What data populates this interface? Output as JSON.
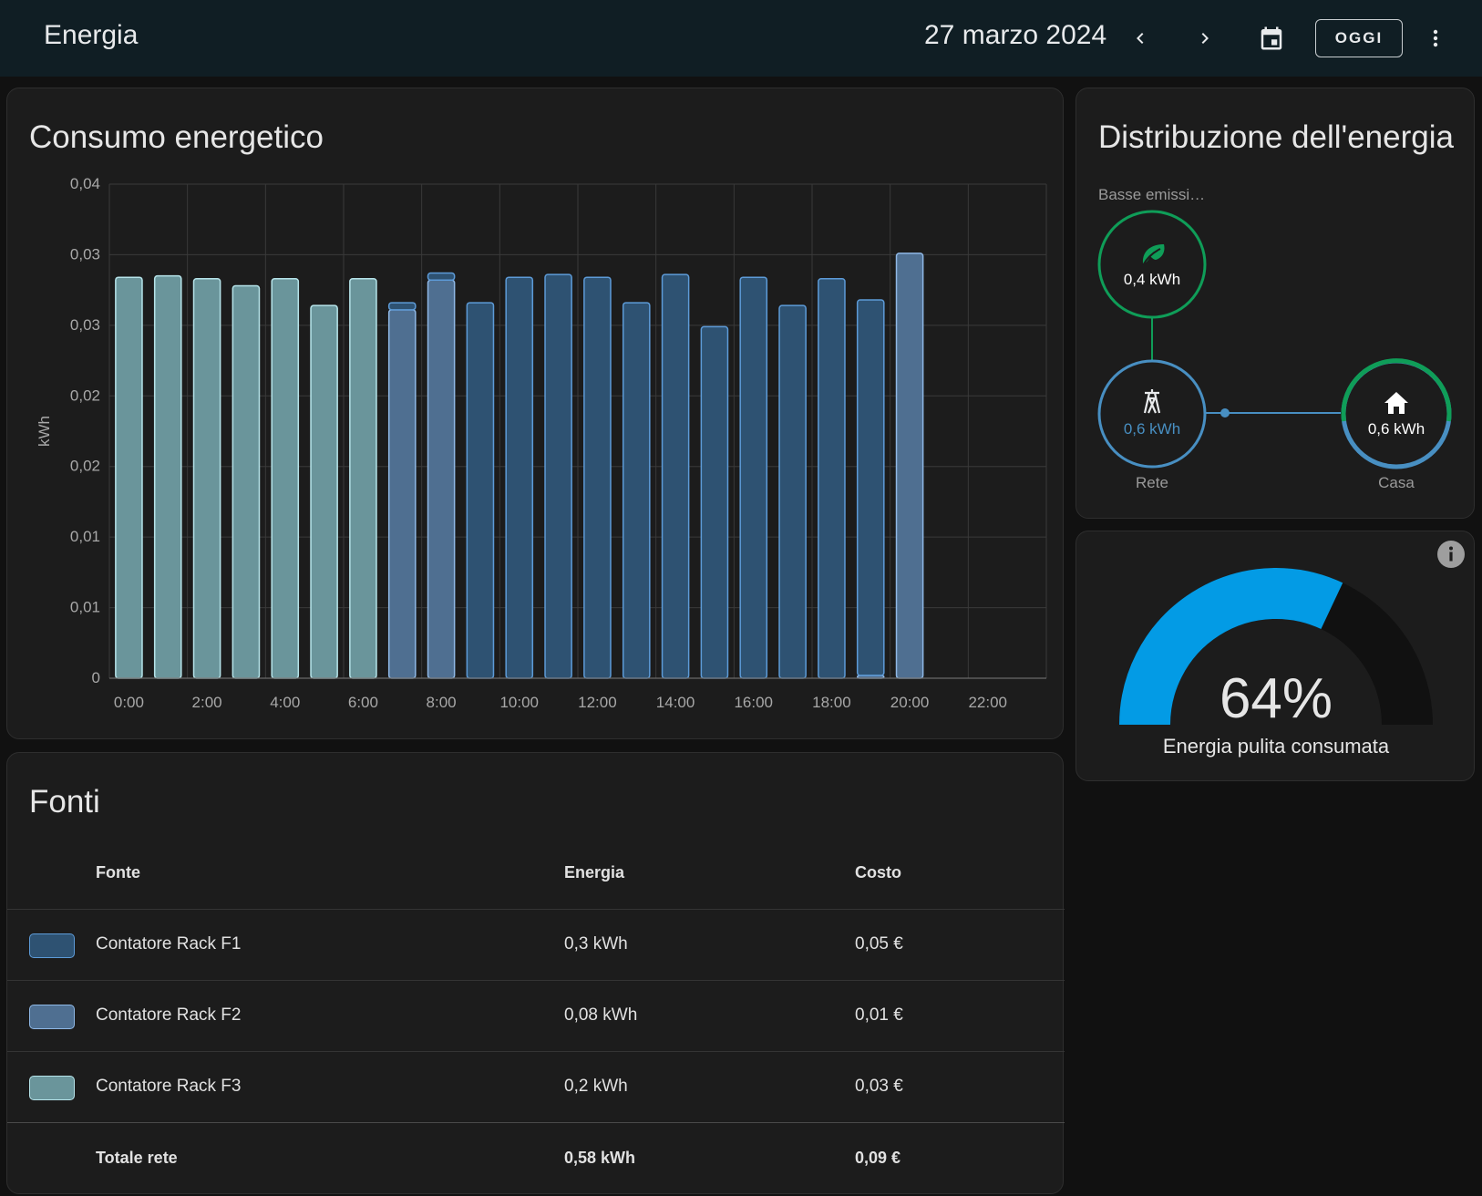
{
  "app": {
    "title": "Energia"
  },
  "header": {
    "date": "27 marzo 2024",
    "today_label": "OGGI"
  },
  "consumption_card": {
    "title": "Consumo energetico"
  },
  "chart_data": {
    "type": "bar",
    "title": "Consumo energetico",
    "xlabel": "",
    "ylabel": "kWh",
    "ylim": [
      0,
      0.035
    ],
    "y_tick_labels": [
      "0",
      "0,01",
      "0,01",
      "0,02",
      "0,02",
      "0,03",
      "0,03",
      "0,04"
    ],
    "x_tick_labels": [
      "0:00",
      "2:00",
      "4:00",
      "6:00",
      "8:00",
      "10:00",
      "12:00",
      "14:00",
      "16:00",
      "18:00",
      "20:00",
      "22:00"
    ],
    "hours": [
      0,
      1,
      2,
      3,
      4,
      5,
      6,
      7,
      8,
      9,
      10,
      11,
      12,
      13,
      14,
      15,
      16,
      17,
      18,
      19,
      20
    ],
    "series": [
      {
        "name": "Contatore Rack F3",
        "color": "#6a959b",
        "stroke": "#b6e4ea",
        "values": [
          0.0284,
          0.0285,
          0.0283,
          0.0278,
          0.0283,
          0.0264,
          0.0283,
          0,
          0,
          0,
          0,
          0,
          0,
          0,
          0,
          0,
          0,
          0,
          0,
          0,
          0
        ]
      },
      {
        "name": "Contatore Rack F2",
        "color": "#4f6f91",
        "stroke": "#8fb8e6",
        "values": [
          0,
          0,
          0,
          0,
          0,
          0,
          0,
          0.0261,
          0.0282,
          0,
          0,
          0,
          0,
          0,
          0,
          0,
          0,
          0,
          0,
          0.0002,
          0.0301
        ]
      },
      {
        "name": "Contatore Rack F1",
        "color": "#2e5272",
        "stroke": "#5d9bd8",
        "values": [
          0,
          0,
          0,
          0,
          0,
          0,
          0,
          0.0005,
          0.0005,
          0.0266,
          0.0284,
          0.0286,
          0.0284,
          0.0266,
          0.0286,
          0.0249,
          0.0284,
          0.0264,
          0.0283,
          0.0266,
          0
        ]
      }
    ],
    "grid": true,
    "legend": "none"
  },
  "sources": {
    "title": "Fonti",
    "headers": {
      "source": "Fonte",
      "energy": "Energia",
      "cost": "Costo"
    },
    "rows": [
      {
        "name": "Contatore Rack F1",
        "energy": "0,3 kWh",
        "cost": "0,05 €",
        "color": "#2e5272",
        "border": "#5d9bd8"
      },
      {
        "name": "Contatore Rack F2",
        "energy": "0,08 kWh",
        "cost": "0,01 €",
        "color": "#4f6f91",
        "border": "#8fb8e6"
      },
      {
        "name": "Contatore Rack F3",
        "energy": "0,2 kWh",
        "cost": "0,03 €",
        "color": "#6a959b",
        "border": "#b6e4ea"
      }
    ],
    "total": {
      "label": "Totale rete",
      "energy": "0,58 kWh",
      "cost": "0,09 €"
    }
  },
  "distribution": {
    "title": "Distribuzione dell'energia",
    "low_carbon": {
      "label": "Basse emissi…",
      "value": "0,4 kWh",
      "color": "#0f9d58"
    },
    "grid": {
      "label": "Rete",
      "value": "0,6 kWh",
      "color": "#488fc2"
    },
    "home": {
      "label": "Casa",
      "value": "0,6 kWh"
    }
  },
  "gauge": {
    "value_percent": 64,
    "value_text": "64%",
    "label": "Energia pulita consumata",
    "color": "#039be5"
  }
}
